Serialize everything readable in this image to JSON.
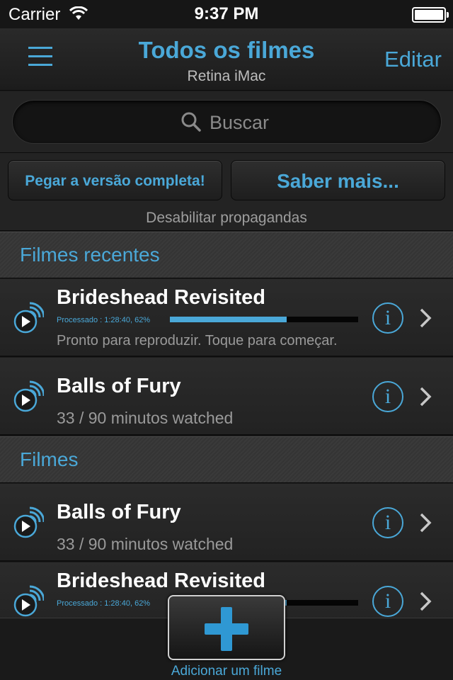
{
  "status": {
    "carrier": "Carrier",
    "time": "9:37 PM"
  },
  "nav": {
    "title": "Todos os filmes",
    "subtitle": "Retina iMac",
    "edit": "Editar"
  },
  "search": {
    "placeholder": "Buscar"
  },
  "ads": {
    "full_version": "Pegar a versão completa!",
    "learn_more": "Saber mais...",
    "disable": "Desabilitar propagandas"
  },
  "sections": {
    "recent": "Filmes recentes",
    "all": "Filmes"
  },
  "recent": [
    {
      "title": "Brideshead Revisited",
      "processed": "Processado : 1:28:40, 62%",
      "progress": 0.62,
      "status": "Pronto para reproduzir. Toque para começar."
    },
    {
      "title": "Balls of Fury",
      "status": "33 / 90 minutos watched"
    }
  ],
  "movies": [
    {
      "title": "Balls of Fury",
      "status": "33 / 90 minutos watched"
    },
    {
      "title": "Brideshead Revisited",
      "processed": "Processado : 1:28:40, 62%",
      "progress": 0.62
    }
  ],
  "add": {
    "label": "Adicionar um filme"
  },
  "colors": {
    "accent": "#4aa8d8",
    "background": "#1c1c1c"
  }
}
